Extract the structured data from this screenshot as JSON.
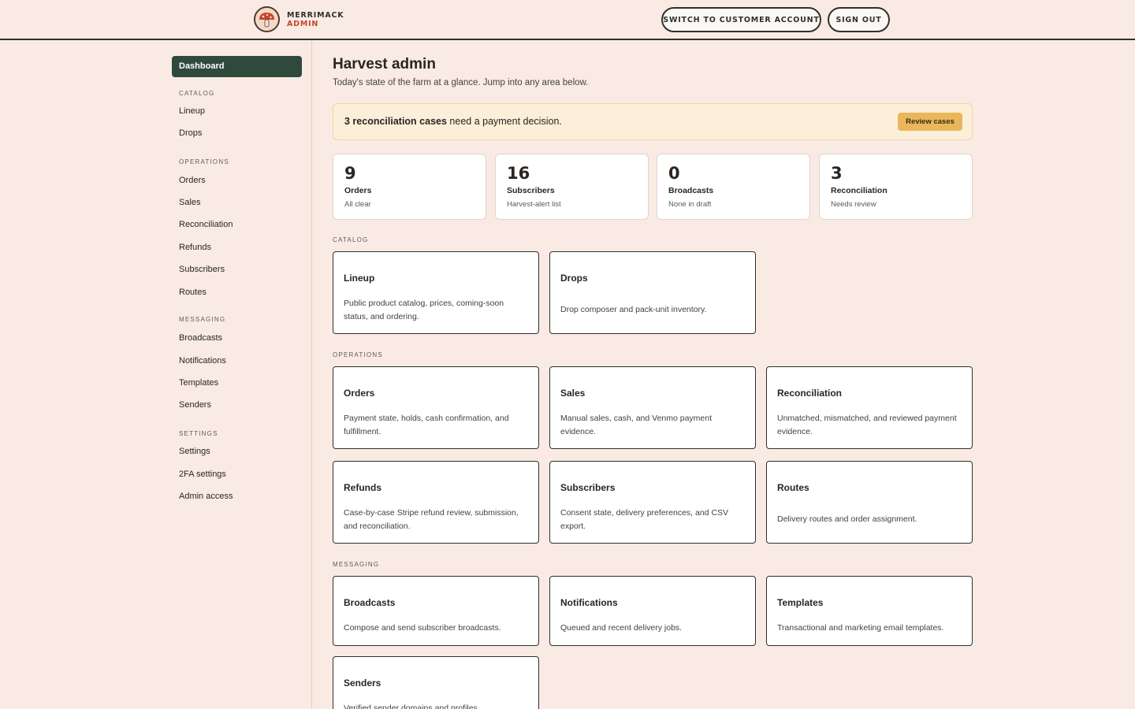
{
  "brand": {
    "name": "MERRIMACK",
    "sub": "ADMIN",
    "logo_icon": "mushroom-icon"
  },
  "header": {
    "switch_label": "SWITCH TO CUSTOMER ACCOUNT",
    "signout_label": "SIGN OUT"
  },
  "sidebar": {
    "dashboard": "Dashboard",
    "catalog": {
      "title": "CATALOG",
      "items": [
        "Lineup",
        "Drops"
      ]
    },
    "operations": {
      "title": "OPERATIONS",
      "items": [
        "Orders",
        "Sales",
        "Reconciliation",
        "Refunds",
        "Subscribers",
        "Routes"
      ]
    },
    "messaging": {
      "title": "MESSAGING",
      "items": [
        "Broadcasts",
        "Notifications",
        "Templates",
        "Senders"
      ]
    },
    "settings": {
      "title": "SETTINGS",
      "items": [
        "Settings",
        "2FA settings",
        "Admin access"
      ]
    }
  },
  "main": {
    "title": "Harvest admin",
    "subtitle": "Today's state of the farm at a glance. Jump into any area below.",
    "alert": {
      "bold": "3 reconciliation cases",
      "rest": " need a payment decision.",
      "button": "Review cases"
    },
    "stats": [
      {
        "num": "9",
        "label": "Orders",
        "note": "All clear"
      },
      {
        "num": "16",
        "label": "Subscribers",
        "note": "Harvest-alert list"
      },
      {
        "num": "0",
        "label": "Broadcasts",
        "note": "None in draft"
      },
      {
        "num": "3",
        "label": "Reconciliation",
        "note": "Needs review"
      }
    ],
    "sections": {
      "catalog": "CATALOG",
      "operations": "OPERATIONS",
      "messaging": "MESSAGING"
    },
    "cards": {
      "lineup": {
        "title": "Lineup",
        "desc": "Public product catalog, prices, coming-soon status, and ordering."
      },
      "drops": {
        "title": "Drops",
        "desc": "Drop composer and pack-unit inventory."
      },
      "orders": {
        "title": "Orders",
        "desc": "Payment state, holds, cash confirmation, and fulfillment."
      },
      "sales": {
        "title": "Sales",
        "desc": "Manual sales, cash, and Venmo payment evidence."
      },
      "reconciliation": {
        "title": "Reconciliation",
        "desc": "Unmatched, mismatched, and reviewed payment evidence."
      },
      "refunds": {
        "title": "Refunds",
        "desc": "Case-by-case Stripe refund review, submission, and reconciliation."
      },
      "subscribers": {
        "title": "Subscribers",
        "desc": "Consent state, delivery preferences, and CSV export."
      },
      "routes": {
        "title": "Routes",
        "desc": "Delivery routes and order assignment."
      },
      "broadcasts": {
        "title": "Broadcasts",
        "desc": "Compose and send subscriber broadcasts."
      },
      "notifications": {
        "title": "Notifications",
        "desc": "Queued and recent delivery jobs."
      },
      "templates": {
        "title": "Templates",
        "desc": "Transactional and marketing email templates."
      },
      "senders": {
        "title": "Senders",
        "desc": "Verified sender domains and profiles."
      }
    }
  }
}
